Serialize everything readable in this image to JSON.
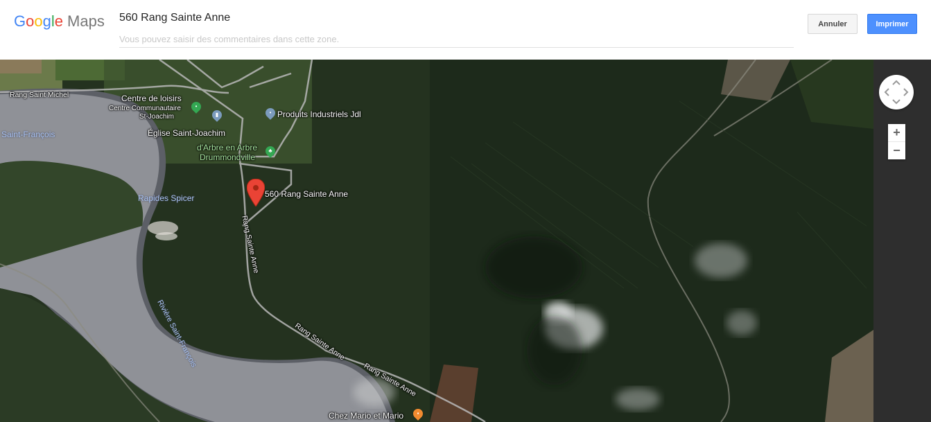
{
  "header": {
    "logo_google": [
      "G",
      "o",
      "o",
      "g",
      "l",
      "e"
    ],
    "logo_maps": "Maps",
    "title": "560 Rang Sainte Anne",
    "comment_placeholder": "Vous pouvez saisir des commentaires dans cette zone.",
    "cancel_label": "Annuler",
    "print_label": "Imprimer"
  },
  "map": {
    "type": "satellite",
    "marker_label": "560 Rang Sainte Anne",
    "places": {
      "rang_saint_michel": "Rang Saint Michel",
      "centre_loisirs": "Centre de loisirs",
      "centre_communautaire_1": "Centre Communautaire",
      "centre_communautaire_2": "St-Joachim",
      "produits": "Produits Industriels Jdl",
      "eglise": "Église Saint-Joachim",
      "arbre_1": "d'Arbre en Arbre",
      "arbre_2": "Drummondville",
      "saint_francois": "Saint-François",
      "rapides": "Rapides Spicer",
      "riviere": "Rivière Saint-François",
      "rang_ste_anne_v": "Rang Sainte Anne",
      "rang_ste_anne_1": "Rang Sainte Anne",
      "rang_ste_anne_2": "Rang Sainte Anne",
      "chez_mario": "Chez Mario et Mario"
    },
    "controls": {
      "zoom_in": "+",
      "zoom_out": "−"
    },
    "colors": {
      "marker": "#ea4335",
      "poi_green": "#34a853",
      "poi_gray": "#7b9bbd",
      "poi_orange": "#f28b30"
    }
  }
}
